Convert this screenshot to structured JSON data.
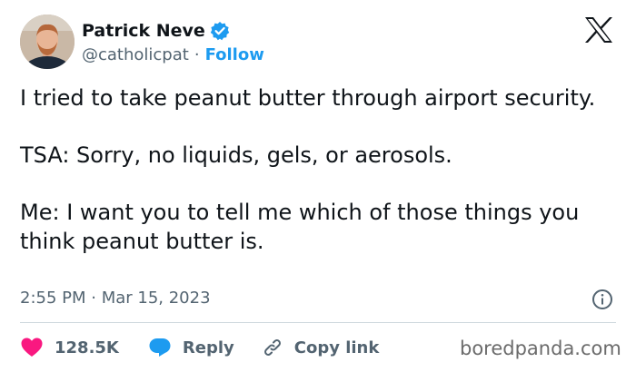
{
  "author": {
    "name": "Patrick Neve",
    "handle": "@catholicpat",
    "separator": "·",
    "follow_label": "Follow"
  },
  "platform_icon": "x-logo-icon",
  "tweet": {
    "lines": [
      "I tried to take peanut butter through airport security.",
      "TSA: Sorry, no liquids, gels, or aerosols.",
      "Me: I want you to tell me which of those things you think peanut butter is."
    ]
  },
  "timestamp": "2:55 PM · Mar 15, 2023",
  "actions": {
    "like_count": "128.5K",
    "reply_label": "Reply",
    "copy_label": "Copy link"
  },
  "watermark": "boredpanda.com",
  "colors": {
    "accent": "#1d9bf0",
    "like": "#f91880",
    "text": "#0f1419",
    "muted": "#536471"
  }
}
